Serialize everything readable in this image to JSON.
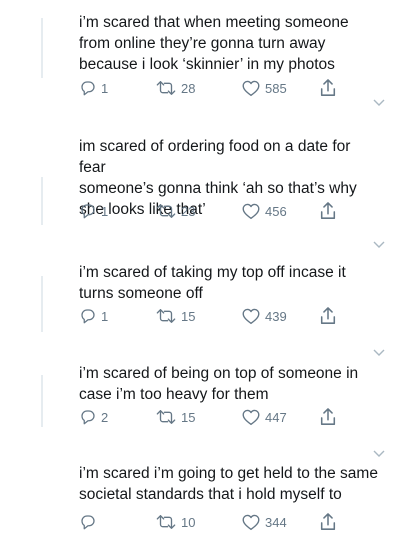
{
  "icons": {
    "reply": "reply-icon",
    "retweet": "retweet-icon",
    "like": "heart-icon",
    "share": "share-icon",
    "more": "chevron-down-icon"
  },
  "colors": {
    "text": "#14171a",
    "icon": "#657786",
    "thread_line": "#e6ecf0"
  },
  "tweets": [
    {
      "text": "i’m scared that when meeting someone\nfrom online they’re gonna turn away\nbecause i look ‘skinnier’ in my photos",
      "replies": "1",
      "retweets": "28",
      "likes": "585"
    },
    {
      "text": "im scared of ordering food on a date for fear\nsomeone’s gonna think ‘ah so that’s why\nshe looks like that’",
      "replies": "1",
      "retweets": "23",
      "likes": "456"
    },
    {
      "text": "i’m scared of taking my top off incase it\nturns someone off",
      "replies": "1",
      "retweets": "15",
      "likes": "439"
    },
    {
      "text": "i’m scared of being on top of someone in\ncase i’m too heavy for them",
      "replies": "2",
      "retweets": "15",
      "likes": "447"
    },
    {
      "text": "i’m scared i’m going to get held to the same\nsocietal standards that i hold myself to",
      "replies": "",
      "retweets": "10",
      "likes": "344"
    }
  ]
}
